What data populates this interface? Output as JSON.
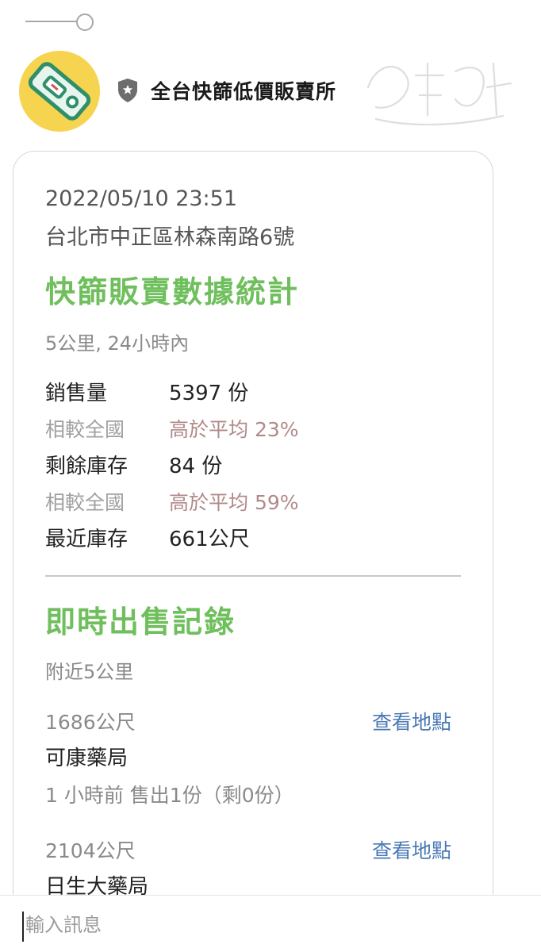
{
  "header": {
    "channel_name": "全台快篩低價販賣所"
  },
  "colors": {
    "accent_green": "#6fbf5d",
    "link_blue": "#4a78b5",
    "avatar_yellow": "#f6d44f",
    "compare_value": "#b08a8a"
  },
  "card": {
    "timestamp": "2022/05/10 23:51",
    "address": "台北市中正區林森南路6號",
    "stats": {
      "title": "快篩販賣數據統計",
      "scope": "5公里, 24小時內",
      "rows": [
        {
          "label": "銷售量",
          "value": "5397 份"
        },
        {
          "label": "相較全國",
          "value": "高於平均 23%"
        },
        {
          "label": "剩餘庫存",
          "value": "84 份"
        },
        {
          "label": "相較全國",
          "value": "高於平均 59%"
        },
        {
          "label": "最近庫存",
          "value": "661公尺"
        }
      ]
    },
    "realtime": {
      "title": "即時出售記錄",
      "scope": "附近5公里",
      "records": [
        {
          "distance": "1686公尺",
          "link": "查看地點",
          "store": "可康藥局",
          "sold": "1 小時前 售出1份（剩0份）"
        },
        {
          "distance": "2104公尺",
          "link": "查看地點",
          "store": "日生大藥局"
        }
      ]
    }
  },
  "input": {
    "placeholder": "輸入訊息"
  }
}
